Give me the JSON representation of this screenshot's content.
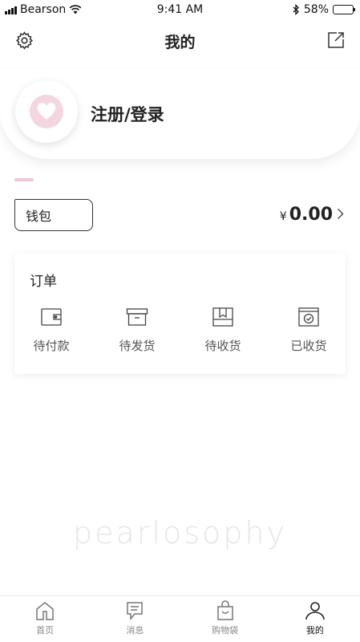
{
  "status_bar": {
    "carrier": "Bearson",
    "time": "9:41 AM",
    "battery_percent": "58%",
    "battery_level": 0.58
  },
  "nav": {
    "title": "我的",
    "left_icon": "gear-icon",
    "right_icon": "share-icon"
  },
  "profile": {
    "login_label": "注册/登录",
    "avatar_icon": "heart-icon"
  },
  "wallet": {
    "label": "钱包",
    "currency": "¥",
    "amount": "0.00",
    "arrow_icon": "chevron-right-icon"
  },
  "orders": {
    "title": "订单",
    "items": [
      {
        "label": "待付款",
        "icon": "wallet-icon"
      },
      {
        "label": "待发货",
        "icon": "box-icon"
      },
      {
        "label": "待收货",
        "icon": "package-icon"
      },
      {
        "label": "已收货",
        "icon": "check-box-icon"
      }
    ]
  },
  "brand": "pearlosophy",
  "tabs": [
    {
      "label": "首页",
      "icon": "home-icon",
      "active": false
    },
    {
      "label": "消息",
      "icon": "message-icon",
      "active": false
    },
    {
      "label": "购物袋",
      "icon": "shopping-bag-icon",
      "active": false
    },
    {
      "label": "我的",
      "icon": "person-icon",
      "active": true
    }
  ],
  "colors": {
    "accent_pink": "#f3d6e0",
    "text": "#222222",
    "muted": "#888888"
  }
}
